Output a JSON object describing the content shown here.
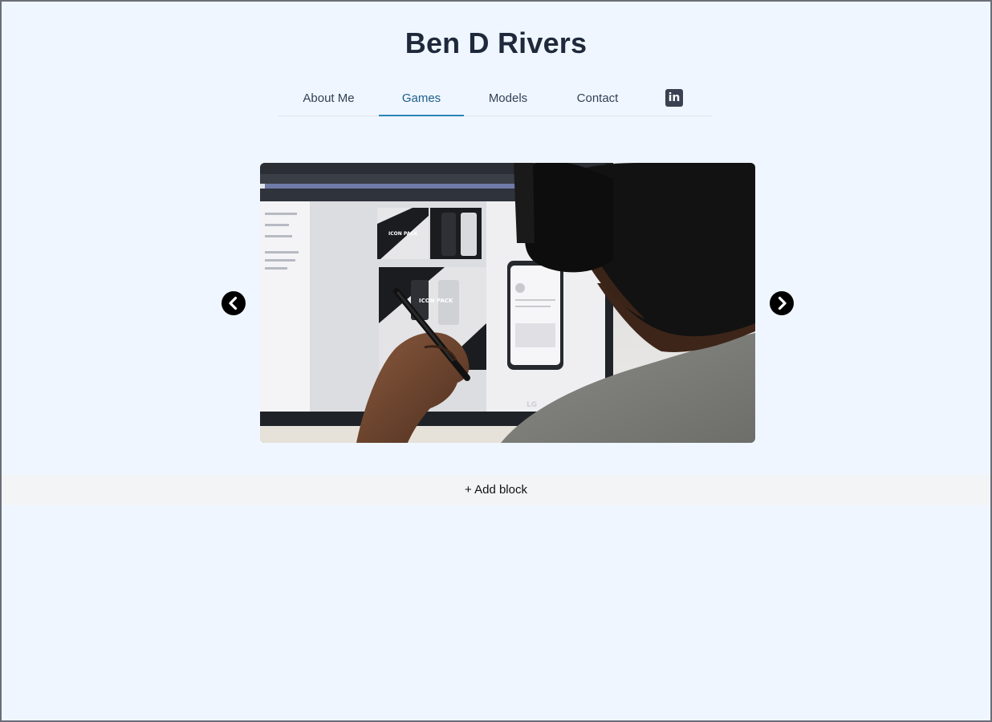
{
  "site": {
    "title": "Ben D Rivers"
  },
  "nav": {
    "items": [
      {
        "label": "About Me",
        "active": false
      },
      {
        "label": "Games",
        "active": true
      },
      {
        "label": "Models",
        "active": false
      },
      {
        "label": "Contact",
        "active": false
      }
    ],
    "social_icon": "linkedin-icon",
    "social_icon_text": "in"
  },
  "carousel": {
    "prev_icon": "chevron-left-icon",
    "next_icon": "chevron-right-icon",
    "image_subject": "person with headphones drawing on a monitor showing a design app",
    "monitor_brand": "LG",
    "screen_text": "ICON PACK"
  },
  "editor": {
    "add_block_label": "+ Add block"
  },
  "colors": {
    "background": "#eff6ff",
    "active_tab": "#1d5f8a",
    "active_underline": "#2b84b8",
    "linkedin_badge": "#3a4150",
    "add_block_bar": "#f3f4f6"
  }
}
